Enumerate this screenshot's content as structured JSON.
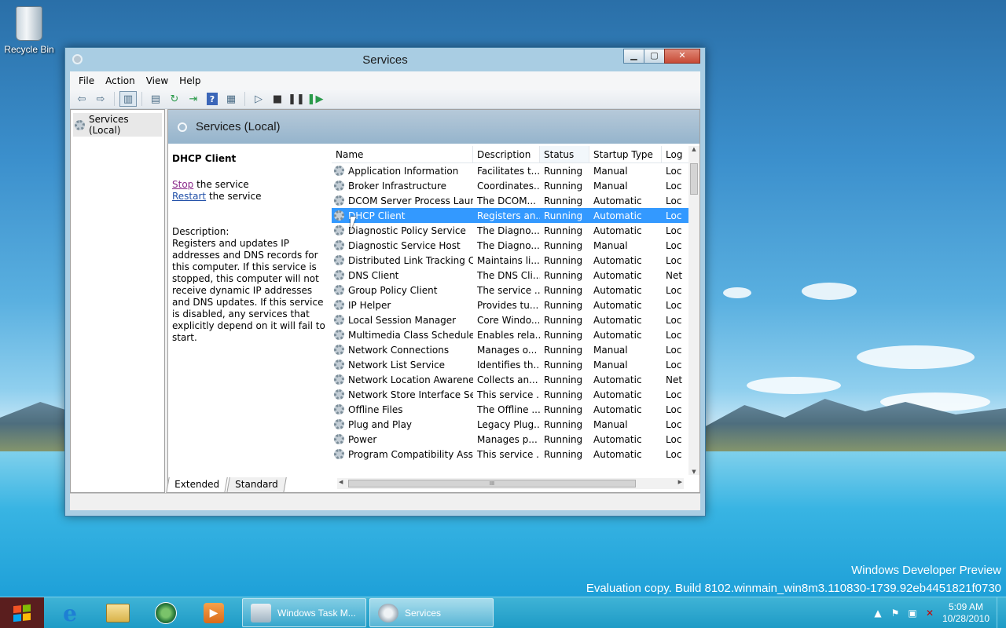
{
  "desktop": {
    "recycle_bin_label": "Recycle Bin",
    "watermark_line1": "Windows Developer Preview",
    "watermark_line2": "Evaluation copy. Build 8102.winmain_win8m3.110830-1739.92eb4451821f0730"
  },
  "window": {
    "title": "Services",
    "menu": [
      "File",
      "Action",
      "View",
      "Help"
    ],
    "tree_root": "Services (Local)",
    "header_title": "Services (Local)",
    "selected_service": {
      "name": "DHCP Client",
      "stop_link": "Stop",
      "stop_suffix": " the service",
      "restart_link": "Restart",
      "restart_suffix": " the service",
      "description_label": "Description:",
      "description": "Registers and updates IP addresses and DNS records for this computer. If this service is stopped, this computer will not receive dynamic IP addresses and DNS updates. If this service is disabled, any services that explicitly depend on it will fail to start."
    },
    "columns": [
      "Name",
      "Description",
      "Status",
      "Startup Type",
      "Log"
    ],
    "rows": [
      {
        "name": "Application Information",
        "description": "Facilitates t...",
        "status": "Running",
        "startup": "Manual",
        "log": "Loc"
      },
      {
        "name": "Broker Infrastructure",
        "description": "Coordinates...",
        "status": "Running",
        "startup": "Manual",
        "log": "Loc"
      },
      {
        "name": "DCOM Server Process Laun...",
        "description": "The DCOM...",
        "status": "Running",
        "startup": "Automatic",
        "log": "Loc"
      },
      {
        "name": "DHCP Client",
        "description": "Registers an...",
        "status": "Running",
        "startup": "Automatic",
        "log": "Loc"
      },
      {
        "name": "Diagnostic Policy Service",
        "description": "The Diagno...",
        "status": "Running",
        "startup": "Automatic",
        "log": "Loc"
      },
      {
        "name": "Diagnostic Service Host",
        "description": "The Diagno...",
        "status": "Running",
        "startup": "Manual",
        "log": "Loc"
      },
      {
        "name": "Distributed Link Tracking Cl...",
        "description": "Maintains li...",
        "status": "Running",
        "startup": "Automatic",
        "log": "Loc"
      },
      {
        "name": "DNS Client",
        "description": "The DNS Cli...",
        "status": "Running",
        "startup": "Automatic",
        "log": "Net"
      },
      {
        "name": "Group Policy Client",
        "description": "The service ...",
        "status": "Running",
        "startup": "Automatic",
        "log": "Loc"
      },
      {
        "name": "IP Helper",
        "description": "Provides tu...",
        "status": "Running",
        "startup": "Automatic",
        "log": "Loc"
      },
      {
        "name": "Local Session Manager",
        "description": "Core Windo...",
        "status": "Running",
        "startup": "Automatic",
        "log": "Loc"
      },
      {
        "name": "Multimedia Class Scheduler",
        "description": "Enables rela...",
        "status": "Running",
        "startup": "Automatic",
        "log": "Loc"
      },
      {
        "name": "Network Connections",
        "description": "Manages o...",
        "status": "Running",
        "startup": "Manual",
        "log": "Loc"
      },
      {
        "name": "Network List Service",
        "description": "Identifies th...",
        "status": "Running",
        "startup": "Manual",
        "log": "Loc"
      },
      {
        "name": "Network Location Awareness",
        "description": "Collects an...",
        "status": "Running",
        "startup": "Automatic",
        "log": "Net"
      },
      {
        "name": "Network Store Interface Ser...",
        "description": "This service ...",
        "status": "Running",
        "startup": "Automatic",
        "log": "Loc"
      },
      {
        "name": "Offline Files",
        "description": "The Offline ...",
        "status": "Running",
        "startup": "Automatic",
        "log": "Loc"
      },
      {
        "name": "Plug and Play",
        "description": "Legacy Plug...",
        "status": "Running",
        "startup": "Manual",
        "log": "Loc"
      },
      {
        "name": "Power",
        "description": "Manages p...",
        "status": "Running",
        "startup": "Automatic",
        "log": "Loc"
      },
      {
        "name": "Program Compatibility Assi...",
        "description": "This service ...",
        "status": "Running",
        "startup": "Automatic",
        "log": "Loc"
      }
    ],
    "selected_row_index": 3,
    "tabs": [
      "Extended",
      "Standard"
    ],
    "scrollbar_grip": "III"
  },
  "taskbar": {
    "buttons": [
      {
        "label": "Windows Task M...",
        "icon": "task-manager-icon"
      },
      {
        "label": "Services",
        "icon": "services-icon"
      }
    ],
    "pinned": [
      "internet-explorer-icon",
      "file-explorer-icon",
      "media-center-icon",
      "media-player-icon"
    ],
    "time": "5:09 AM",
    "date": "10/28/2010"
  },
  "colors": {
    "selection": "#3399ff",
    "start_button": "#5a1e1e",
    "taskbar": "#1e9bc6"
  }
}
